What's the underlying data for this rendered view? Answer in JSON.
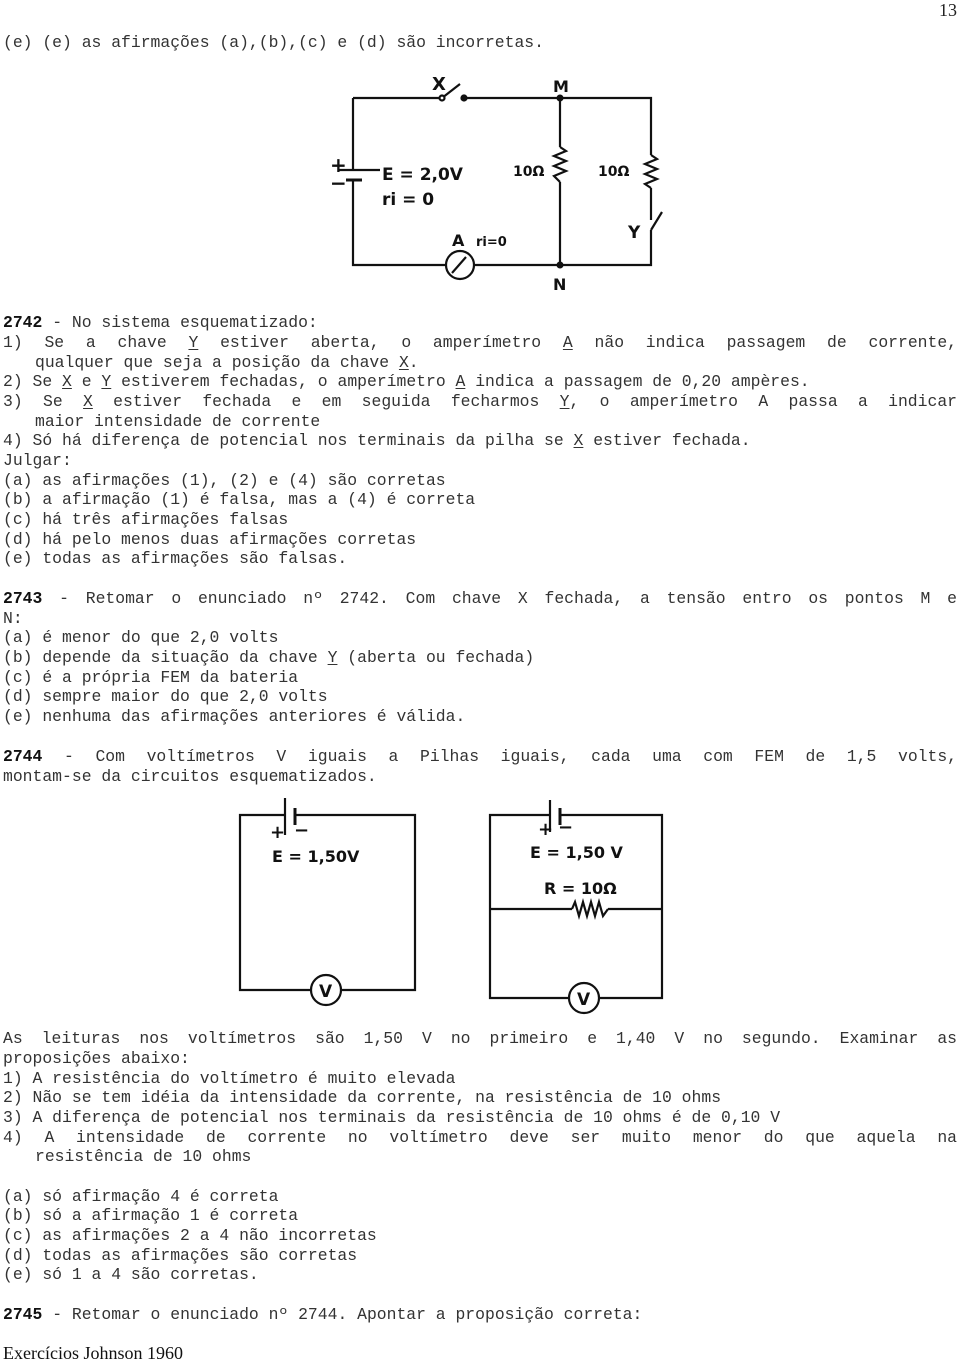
{
  "page_number": "13",
  "footer": "Exercícios Johnson 1960",
  "prev_tail": "(e) (e) as afirmações (a),(b),(c) e (d) são incorretas.",
  "circuit1": {
    "switch_x": "X",
    "switch_y": "Y",
    "node_m": "M",
    "node_n": "N",
    "plus": "+",
    "minus": "−",
    "emf": "E = 2,0V",
    "internal_r": "ri = 0",
    "r1": "10Ω",
    "r2": "10Ω",
    "ammeter": "A",
    "ammeter_r": "ri=0"
  },
  "q2742": {
    "number": "2742",
    "intro": " - No sistema esquematizado:",
    "statements": [
      {
        "n": "1)",
        "a": "Se a chave ",
        "u": "Y",
        "b": " estiver aberta, o amperímetro ",
        "u2": "A",
        "c": " não indica passagem de corrente,",
        "cont": "qualquer que seja a posição da chave ",
        "cont_u": "X",
        "cont_end": "."
      },
      {
        "n": "2)",
        "text_a": "Se ",
        "u1": "X",
        "text_b": " e ",
        "u2": "Y",
        "text_c": " estiverem fechadas, o amperímetro ",
        "u3": "A",
        "text_d": " indica a passagem de 0,20 ampères."
      },
      {
        "n": "3)",
        "text_a": "Se ",
        "u1": "X",
        "text_b": " estiver fechada e em seguida fecharmos ",
        "u2": "Y",
        "text_c": ", o amperímetro A passa a indicar",
        "cont": "maior intensidade de corrente"
      },
      {
        "n": "4)",
        "text_a": "Só há diferença de potencial nos terminais da pilha se ",
        "u1": "X",
        "text_b": " estiver fechada."
      }
    ],
    "judge_label": "Julgar:",
    "options": [
      "(a) as afirmações (1), (2) e (4) são corretas",
      "(b) a afirmação (1) é falsa, mas a (4) é correta",
      "(c) há três afirmações falsas",
      "(d) há pelo menos duas afirmações corretas",
      "(e) todas as afirmações são falsas."
    ]
  },
  "q2743": {
    "number": "2743",
    "intro": " - Retomar o enunciado nº 2742. Com chave X fechada, a tensão entro os pontos M e",
    "intro_cont": "N:",
    "options": [
      {
        "t": "(a) é menor do que 2,0 volts"
      },
      {
        "t_a": "(b) depende da situação da chave ",
        "u": "Y",
        "t_b": " (aberta ou fechada)"
      },
      {
        "t": "(c) é a própria FEM da bateria"
      },
      {
        "t": "(d) sempre maior do que 2,0 volts"
      },
      {
        "t": "(e) nenhuma das afirmações anteriores é válida."
      }
    ]
  },
  "q2744": {
    "number": "2744",
    "intro": " - Com voltímetros V iguais a Pilhas iguais, cada uma com FEM de 1,5 volts,",
    "intro_cont": "montam-se da circuitos esquematizados.",
    "circuit_a": {
      "plus": "+",
      "minus": "−",
      "emf": "E = 1,50V",
      "meter": "V"
    },
    "circuit_b": {
      "plus": "+",
      "minus": "−",
      "emf": "E = 1,50 V",
      "resistor": "R = 10Ω",
      "meter": "V"
    },
    "readings": "As leituras nos voltímetros são 1,50 V no primeiro e 1,40 V no segundo. Examinar as",
    "readings_cont": "proposições abaixo:",
    "statements": [
      "1) A resistência do voltímetro é muito elevada",
      "2) Não se tem idéia da intensidade da corrente, na resistência de 10 ohms",
      "3) A diferença de potencial nos terminais da resistência de 10 ohms é de 0,10 V",
      "4) A intensidade de corrente no voltímetro deve ser muito menor do que aquela na"
    ],
    "statement4_cont": "resistência de 10 ohms",
    "options": [
      "(a) só afirmação 4 é correta",
      "(b) só a afirmação 1 é correta",
      "(c) as afirmações 2 a 4 não incorretas",
      "(d) todas as afirmações são corretas",
      "(e) só 1 a 4 são corretas."
    ]
  },
  "q2745": {
    "number": "2745",
    "intro": " - Retomar o enunciado nº 2744. Apontar a proposição correta:"
  }
}
